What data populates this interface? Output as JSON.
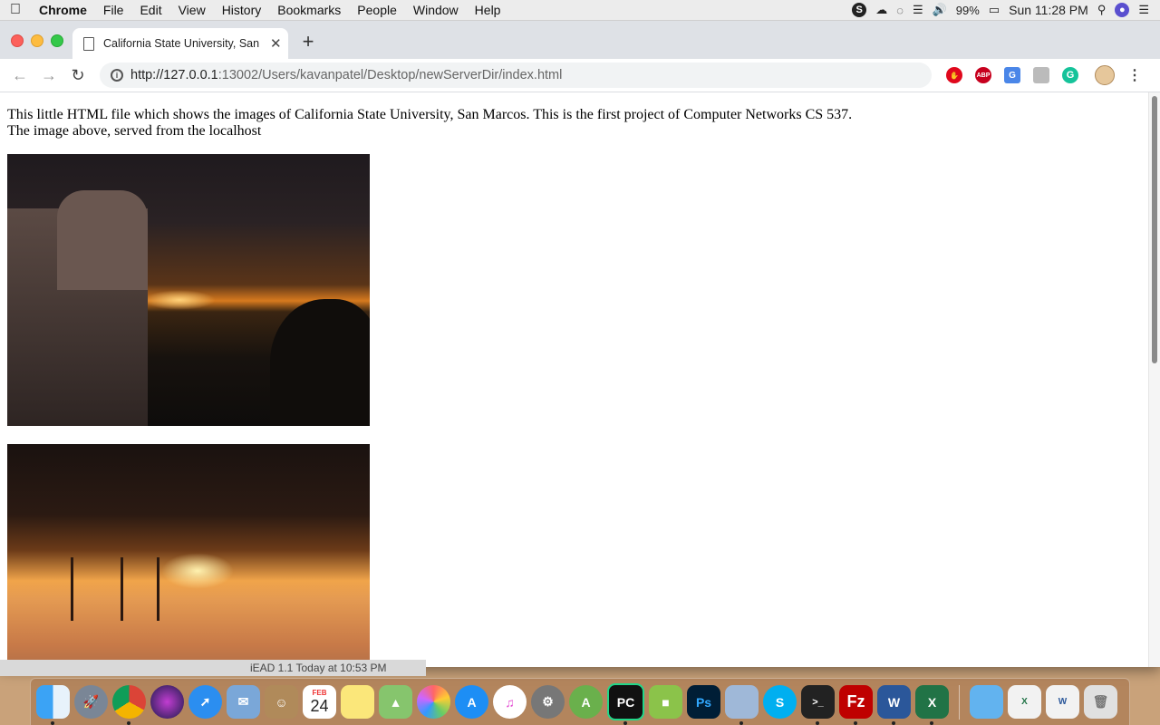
{
  "menubar": {
    "app_name": "Chrome",
    "items": [
      "File",
      "Edit",
      "View",
      "History",
      "Bookmarks",
      "People",
      "Window",
      "Help"
    ],
    "battery": "99%",
    "clock": "Sun 11:28 PM"
  },
  "tab": {
    "title": "California State University, San"
  },
  "toolbar": {
    "url_host": "http://127.0.0.1",
    "url_rest": ":13002/Users/kavanpatel/Desktop/newServerDir/index.html"
  },
  "page": {
    "line1": "This little HTML file which shows the images of California State University, San Marcos. This is the first project of Computer Networks CS 537.",
    "line2": "The image above, served from the localhost"
  },
  "behind_window": {
    "text": "iEAD 1.1      Today at 10:53 PM"
  },
  "dock": {
    "calendar_month": "FEB",
    "calendar_day": "24",
    "apps": [
      "Finder",
      "Launchpad",
      "Chrome",
      "Siri",
      "Safari",
      "Mail",
      "Contacts",
      "Calendar",
      "Notes",
      "Maps",
      "Photos",
      "App Store",
      "iTunes",
      "System Preferences",
      "Android Studio",
      "PyCharm",
      "Android",
      "Photoshop",
      "VirtualBox",
      "Skype",
      "Terminal",
      "FileZilla",
      "Word",
      "Excel",
      "Folder",
      "Excel Document",
      "Word Document",
      "Trash"
    ]
  },
  "colors": {
    "menubar_bg": "#ececec",
    "tabstrip_bg": "#dee1e6",
    "omnibox_bg": "#f1f3f4"
  }
}
